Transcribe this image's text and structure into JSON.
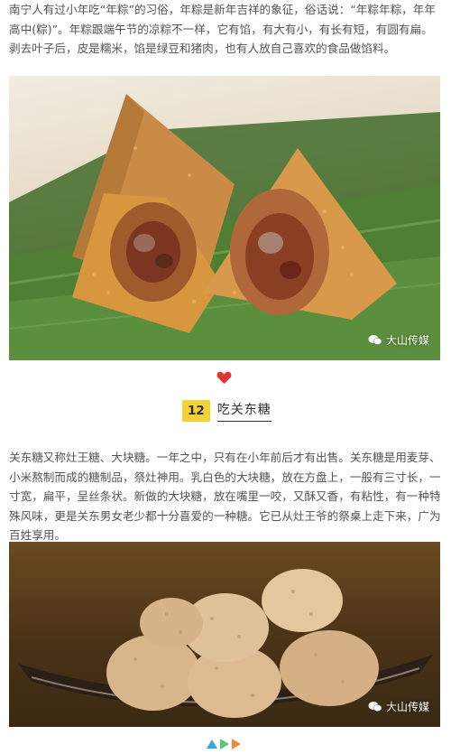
{
  "article": {
    "paragraph1": "南宁人有过小年吃“年粽”的习俗，年粽是新年吉祥的象征，俗话说：“年粽年粽，年年高中(粽)”。年粽跟端午节的凉粽不一样，它有馅，有大有小，有长有短，有圆有扁。剥去叶子后，皮是糯米，馅是绿豆和猪肉，也有人放自己喜欢的食品做馅料。",
    "paragraph2": "关东糖又称灶王糖、大块糖。一年之中，只有在小年前后才有出售。关东糖是用麦芽、小米熬制而成的糖制品，祭灶神用。乳白色的大块糖，放在方盘上，一般有三寸长，一寸宽，扁平，呈丝条状。新做的大块糖，放在嘴里一咬，又酥又香，有粘性，有一种特殊风味，更是关东男女老少都十分喜爱的一种糖。它已从灶王爷的祭桌上走下来，广为百姓享用。",
    "section": {
      "number": "12",
      "title": "吃关东糖"
    },
    "images": [
      {
        "watermark": "大山传媒",
        "icon": "wechat-icon"
      },
      {
        "watermark": "大山传媒",
        "icon": "wechat-icon"
      }
    ],
    "divider_icon": "heart-icon",
    "footer_icons": [
      "triangle-up-icon",
      "triangle-right-icon",
      "triangle-right-icon"
    ]
  },
  "colors": {
    "text": "#555555",
    "section_badge": "#f5d234",
    "heart": "#e4342f",
    "arrow_blue": "#3aa6e0",
    "arrow_green": "#5cc47a",
    "arrow_orange": "#f08a3a"
  }
}
